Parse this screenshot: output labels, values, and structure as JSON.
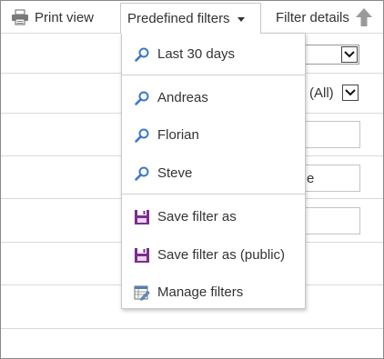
{
  "toolbar": {
    "print_label": "Print view",
    "filters_label": "Predefined filters",
    "details_label": "Filter details"
  },
  "background_fields": {
    "select_2_value": "(All)",
    "input_2_value": "e"
  },
  "menu": {
    "items": [
      {
        "label": "Last 30 days",
        "icon": "search-icon"
      },
      {
        "label": "Andreas",
        "icon": "search-icon"
      },
      {
        "label": "Florian",
        "icon": "search-icon"
      },
      {
        "label": "Steve",
        "icon": "search-icon"
      },
      {
        "label": "Save filter as",
        "icon": "floppy-disk-icon"
      },
      {
        "label": "Save filter as (public)",
        "icon": "floppy-disk-icon"
      },
      {
        "label": "Manage filters",
        "icon": "manage-filters-icon"
      }
    ]
  },
  "colors": {
    "search_icon": "#3c78c8",
    "save_icon": "#7b2d8e",
    "border": "#c8c8c8",
    "text": "#333333"
  }
}
